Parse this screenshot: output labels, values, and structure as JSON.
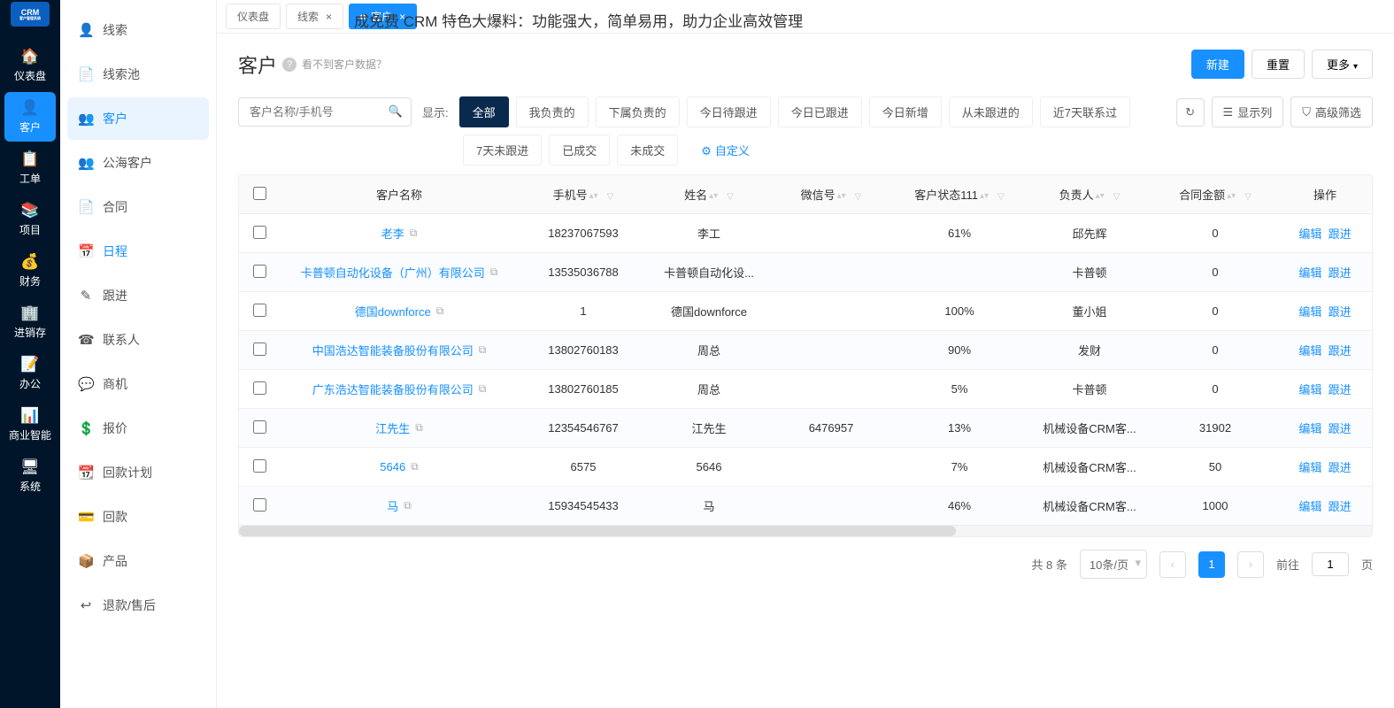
{
  "promo_text": "成免费 CRM 特色大爆料：功能强大，简单易用，助力企业高效管理",
  "rail": {
    "logo": "CRM",
    "logo_sub": "客户管理系统",
    "items": [
      {
        "icon": "🏠",
        "label": "仪表盘"
      },
      {
        "icon": "👤",
        "label": "客户"
      },
      {
        "icon": "📋",
        "label": "工单"
      },
      {
        "icon": "📚",
        "label": "项目"
      },
      {
        "icon": "💰",
        "label": "财务"
      },
      {
        "icon": "🏢",
        "label": "进销存"
      },
      {
        "icon": "📝",
        "label": "办公"
      },
      {
        "icon": "📊",
        "label": "商业智能"
      },
      {
        "icon": "🖥",
        "label": "系统"
      }
    ],
    "active_index": 1
  },
  "subnav": {
    "items": [
      {
        "icon": "👤",
        "label": "线索"
      },
      {
        "icon": "📄",
        "label": "线索池"
      },
      {
        "icon": "👥",
        "label": "客户"
      },
      {
        "icon": "👥",
        "label": "公海客户"
      },
      {
        "icon": "📄",
        "label": "合同"
      },
      {
        "icon": "📅",
        "label": "日程"
      },
      {
        "icon": "✎",
        "label": "跟进"
      },
      {
        "icon": "☎",
        "label": "联系人"
      },
      {
        "icon": "💬",
        "label": "商机"
      },
      {
        "icon": "💲",
        "label": "报价"
      },
      {
        "icon": "📆",
        "label": "回款计划"
      },
      {
        "icon": "💳",
        "label": "回款"
      },
      {
        "icon": "📦",
        "label": "产品"
      },
      {
        "icon": "↩",
        "label": "退款/售后"
      }
    ],
    "active_index": 2
  },
  "tabs": {
    "items": [
      {
        "label": "仪表盘"
      },
      {
        "label": "线索"
      },
      {
        "label": "客户"
      }
    ],
    "active_index": 2
  },
  "page": {
    "title": "客户",
    "hint": "看不到客户数据？",
    "actions": {
      "new": "新建",
      "reset": "重置",
      "more": "更多"
    }
  },
  "search": {
    "placeholder": "客户名称/手机号"
  },
  "filter_label": "显示:",
  "pills_row1": [
    "全部",
    "我负责的",
    "下属负责的",
    "今日待跟进",
    "今日已跟进",
    "今日新增",
    "从未跟进的",
    "近7天联系过"
  ],
  "pills_row2": [
    "7天未跟进",
    "已成交",
    "未成交"
  ],
  "pill_custom": "自定义",
  "toolbar_right": {
    "refresh": "↻",
    "columns": "显示列",
    "advanced": "高级筛选"
  },
  "columns": [
    "",
    "客户名称",
    "手机号",
    "姓名",
    "微信号",
    "客户状态111",
    "负责人",
    "合同金额",
    "操作"
  ],
  "ops": {
    "edit": "编辑",
    "follow": "跟进"
  },
  "rows": [
    {
      "name": "老李",
      "phone": "18237067593",
      "xm": "李工",
      "wx": "",
      "status": "61%",
      "owner": "邱先辉",
      "amount": "0"
    },
    {
      "name": "卡普顿自动化设备（广州）有限公司",
      "phone": "13535036788",
      "xm": "卡普顿自动化设...",
      "wx": "",
      "status": "",
      "owner": "卡普顿",
      "amount": "0"
    },
    {
      "name": "德国downforce",
      "phone": "1",
      "xm": "德国downforce",
      "wx": "",
      "status": "100%",
      "owner": "董小姐",
      "amount": "0"
    },
    {
      "name": "中国浩达智能装备股份有限公司",
      "phone": "13802760183",
      "xm": "周总",
      "wx": "",
      "status": "90%",
      "owner": "发财",
      "amount": "0"
    },
    {
      "name": "广东浩达智能装备股份有限公司",
      "phone": "13802760185",
      "xm": "周总",
      "wx": "",
      "status": "5%",
      "owner": "卡普顿",
      "amount": "0"
    },
    {
      "name": "江先生",
      "phone": "12354546767",
      "xm": "江先生",
      "wx": "6476957",
      "status": "13%",
      "owner": "机械设备CRM客...",
      "amount": "31902"
    },
    {
      "name": "5646",
      "phone": "6575",
      "xm": "5646",
      "wx": "",
      "status": "7%",
      "owner": "机械设备CRM客...",
      "amount": "50"
    },
    {
      "name": "马",
      "phone": "15934545433",
      "xm": "马",
      "wx": "",
      "status": "46%",
      "owner": "机械设备CRM客...",
      "amount": "1000"
    }
  ],
  "pager": {
    "total": "共 8 条",
    "size": "10条/页",
    "current": "1",
    "goto": "前往",
    "goto_val": "1",
    "page_unit": "页"
  }
}
